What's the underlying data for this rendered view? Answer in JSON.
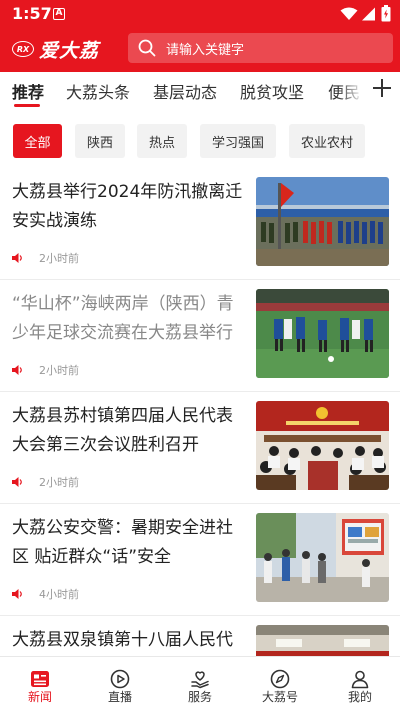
{
  "status_bar": {
    "time": "1:57",
    "notification_badge": "A"
  },
  "header": {
    "logo_mark": "RX",
    "app_name": "爱大荔",
    "search_placeholder": "请输入关键字",
    "accent_color": "#e6161f"
  },
  "channel_tabs": [
    {
      "label": "推荐",
      "active": true
    },
    {
      "label": "大荔头条",
      "active": false
    },
    {
      "label": "基层动态",
      "active": false
    },
    {
      "label": "脱贫攻坚",
      "active": false
    },
    {
      "label": "便民",
      "active": false
    }
  ],
  "filter_chips": [
    {
      "label": "全部",
      "active": true
    },
    {
      "label": "陕西",
      "active": false
    },
    {
      "label": "热点",
      "active": false
    },
    {
      "label": "学习强国",
      "active": false
    },
    {
      "label": "农业农村",
      "active": false
    }
  ],
  "news": [
    {
      "title": "大荔县举行2024年防汛撤离迁安实战演练",
      "time": "2小时前",
      "read": false,
      "thumb": "flood-drill"
    },
    {
      "title": "“华山杯”海峡两岸（陕西）青少年足球交流赛在大荔县举行",
      "time": "2小时前",
      "read": true,
      "thumb": "football"
    },
    {
      "title": "大荔县苏村镇第四届人民代表大会第三次会议胜利召开",
      "time": "2小时前",
      "read": false,
      "thumb": "meeting"
    },
    {
      "title": "大荔公安交警：暑期安全进社区 贴近群众“话”安全",
      "time": "4小时前",
      "read": false,
      "thumb": "community"
    },
    {
      "title": "大荔县双泉镇第十八届人民代",
      "time": "",
      "read": false,
      "thumb": "hall"
    }
  ],
  "bottom_nav": [
    {
      "label": "新闻",
      "icon": "news-icon",
      "active": true
    },
    {
      "label": "直播",
      "icon": "live-icon",
      "active": false
    },
    {
      "label": "服务",
      "icon": "service-icon",
      "active": false
    },
    {
      "label": "大荔号",
      "icon": "compass-icon",
      "active": false
    },
    {
      "label": "我的",
      "icon": "profile-icon",
      "active": false
    }
  ]
}
